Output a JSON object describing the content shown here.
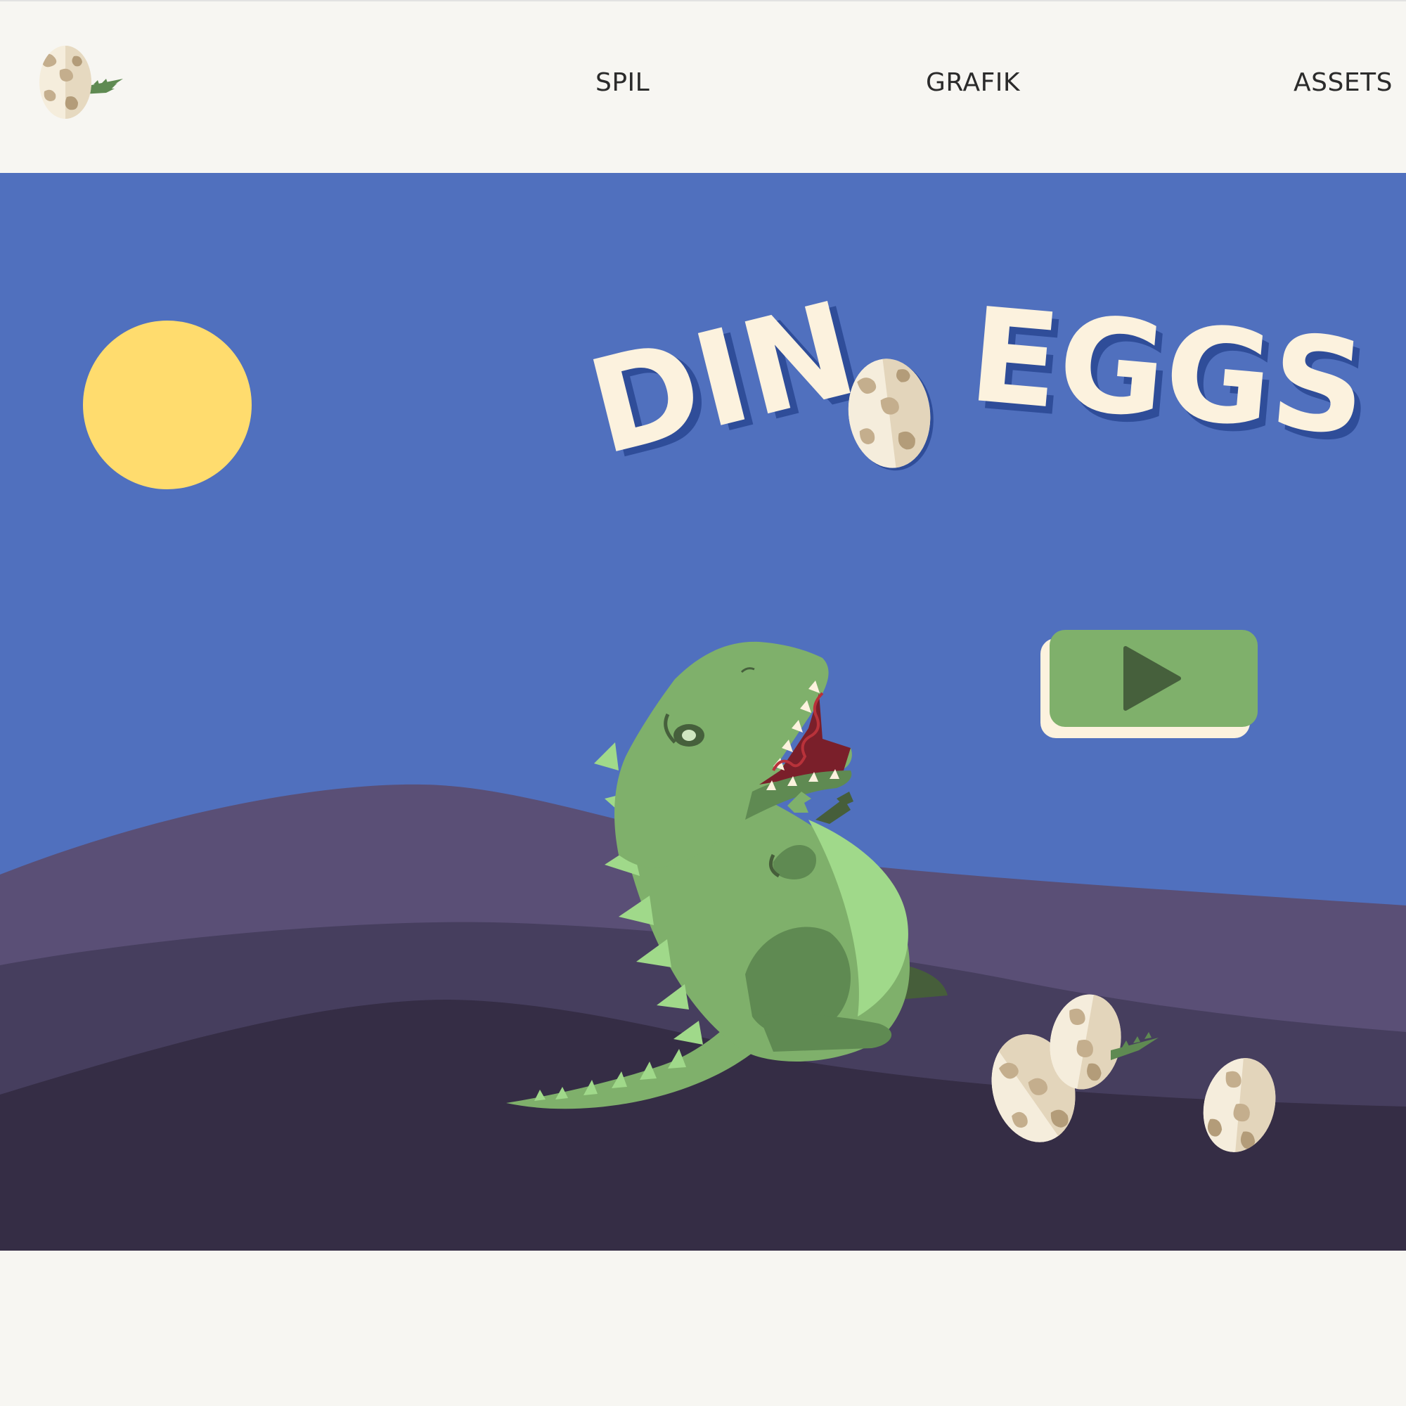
{
  "nav": {
    "logo_icon": "dino-egg-logo-icon",
    "items": [
      {
        "label": "SPIL"
      },
      {
        "label": "GRAFIK"
      },
      {
        "label": "ASSETS"
      }
    ]
  },
  "game": {
    "title": {
      "word1": "DIN",
      "word2": "EGGS"
    },
    "play_button_icon": "play-icon",
    "colors": {
      "sky": "#5070be",
      "sun": "#ffdc6e",
      "hill_far": "#5a4f76",
      "hill_mid": "#463e5e",
      "ground": "#352d45",
      "dino": "#7fb06b",
      "dino_light": "#a0d98a",
      "dino_dark": "#5f8a52",
      "egg_base": "#f5eddc",
      "egg_spot": "#c4ae8d",
      "title_fill": "#fcf2de",
      "title_shadow": "#2f4d99",
      "button": "#7fb06b",
      "button_icon": "#46603c"
    }
  }
}
